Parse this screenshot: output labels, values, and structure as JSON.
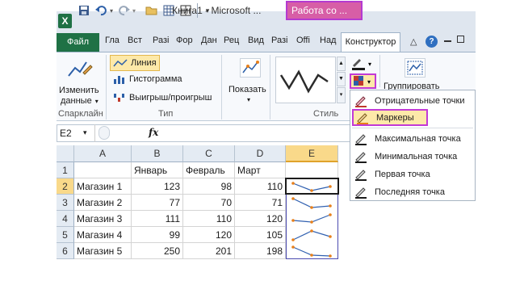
{
  "title_bar": {
    "workbook_title": "Книга1 - Microsoft ...",
    "context_title": "Работа со ..."
  },
  "tabs": {
    "file": "Файл",
    "items": [
      "Гла",
      "Вст",
      "Разі",
      "Фор",
      "Дан",
      "Рец",
      "Вид",
      "Разі",
      "Offi",
      "Над"
    ],
    "design": "Конструктор"
  },
  "ribbon": {
    "sparkline_group": {
      "edit_label_1": "Изменить",
      "edit_label_2": "данные",
      "group_label": "Спарклайн"
    },
    "type_group": {
      "line": "Линия",
      "column": "Гистограмма",
      "winloss": "Выигрыш/проигрыш",
      "group_label": "Тип"
    },
    "show_group": {
      "label": "Показать"
    },
    "style_group": {
      "group_label": "Стиль"
    },
    "group_button": "Группировать"
  },
  "formula_bar": {
    "cell_ref": "E2",
    "fx": "fx"
  },
  "grid": {
    "columns": [
      "A",
      "B",
      "C",
      "D",
      "E"
    ],
    "row_numbers": [
      "1",
      "2",
      "3",
      "4",
      "5",
      "6"
    ],
    "header_row": [
      "",
      "Январь",
      "Февраль",
      "Март"
    ],
    "rows": [
      [
        "Магазин 1",
        "123",
        "98",
        "110"
      ],
      [
        "Магазин 2",
        "77",
        "70",
        "71"
      ],
      [
        "Магазин 3",
        "111",
        "110",
        "120"
      ],
      [
        "Магазин 4",
        "99",
        "120",
        "105"
      ],
      [
        "Магазин 5",
        "250",
        "201",
        "198"
      ]
    ]
  },
  "dropdown": {
    "items": [
      "Отрицательные точки",
      "Маркеры",
      "Максимальная точка",
      "Минимальная точка",
      "Первая точка",
      "Последняя точка"
    ],
    "highlighted_index": 1
  },
  "colors": {
    "excel_green": "#1f7145",
    "context_tab": "#d75ea6",
    "highlight_border": "#c23ad6",
    "sparkline_line": "#3060b0",
    "sparkline_marker": "#e8801a"
  }
}
